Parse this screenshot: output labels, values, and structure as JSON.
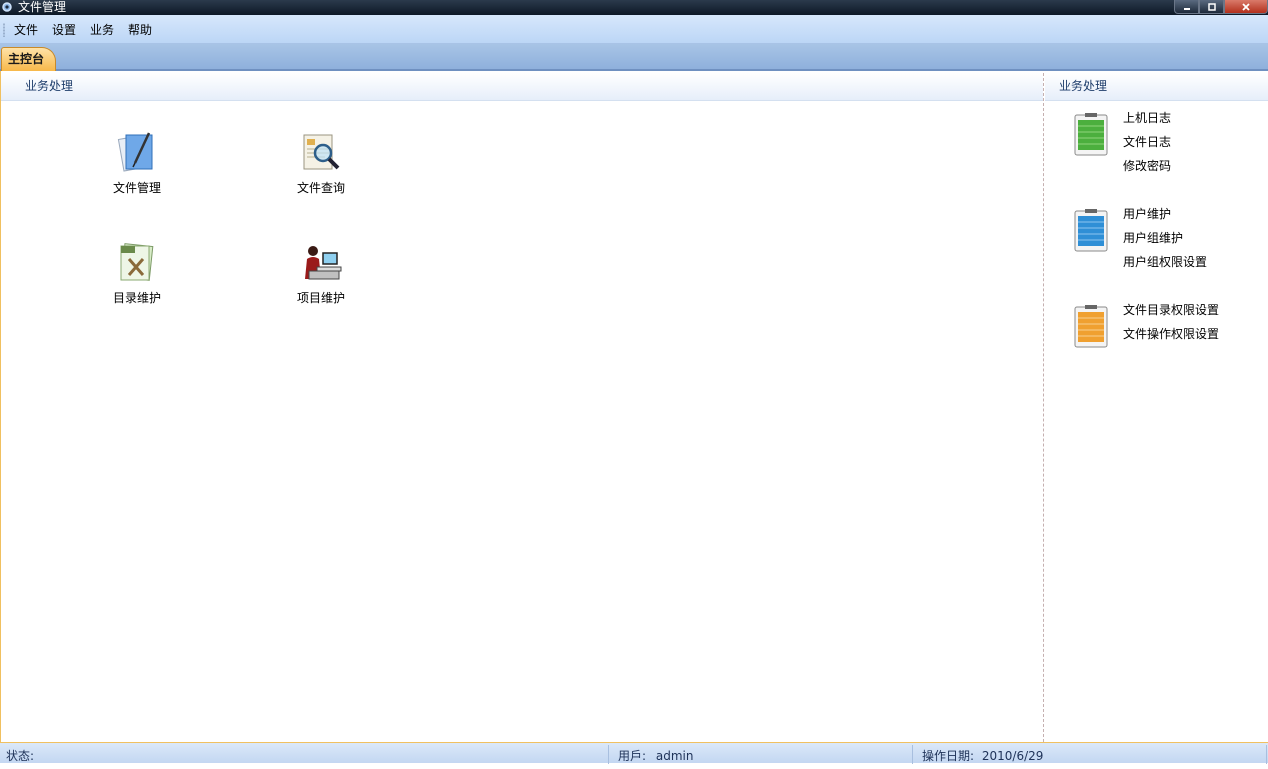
{
  "window": {
    "title": "文件管理",
    "icon": "gear-app-icon"
  },
  "window_controls": {
    "minimize_icon": "minimize-icon",
    "maximize_icon": "maximize-icon",
    "close_icon": "close-icon"
  },
  "menubar": {
    "items": [
      {
        "label": "文件"
      },
      {
        "label": "设置"
      },
      {
        "label": "业务"
      },
      {
        "label": "帮助"
      }
    ]
  },
  "tabs": [
    {
      "label": "主控台",
      "active": true
    }
  ],
  "left_panel": {
    "title": "业务处理",
    "tiles": [
      {
        "label": "文件管理",
        "icon": "file-manage-icon"
      },
      {
        "label": "文件查询",
        "icon": "file-search-icon"
      },
      {
        "label": "目录维护",
        "icon": "directory-maintain-icon"
      },
      {
        "label": "项目维护",
        "icon": "project-maintain-icon"
      }
    ]
  },
  "right_panel": {
    "title": "业务处理",
    "groups": [
      {
        "icon": "green-notepad-icon",
        "color": "#4caf3e",
        "links": [
          {
            "label": "上机日志"
          },
          {
            "label": "文件日志"
          },
          {
            "label": "修改密码"
          }
        ]
      },
      {
        "icon": "blue-notepad-icon",
        "color": "#2f8fd6",
        "links": [
          {
            "label": "用户维护"
          },
          {
            "label": "用户组维护"
          },
          {
            "label": "用户组权限设置"
          }
        ]
      },
      {
        "icon": "orange-notepad-icon",
        "color": "#f0a030",
        "links": [
          {
            "label": "文件目录权限设置"
          },
          {
            "label": "文件操作权限设置"
          }
        ]
      }
    ]
  },
  "statusbar": {
    "status_label": "状态:",
    "user_label": "用戶:",
    "user_value": "admin",
    "date_label": "操作日期:",
    "date_value": "2010/6/29"
  },
  "colors": {
    "accent": "#bcd6f6",
    "tab_active": "#f7b84a",
    "header_text": "#1e3d6b"
  }
}
